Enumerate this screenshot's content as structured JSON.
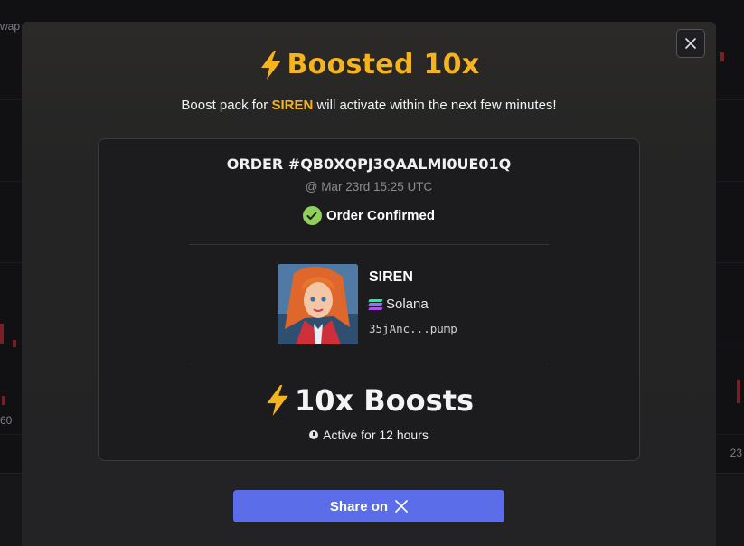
{
  "background": {
    "left_label": "wap",
    "price_label": "60",
    "right_label": "23"
  },
  "modal": {
    "title": "Boosted 10x",
    "subtitle_prefix": "Boost pack for",
    "subtitle_token": "SIREN",
    "subtitle_suffix": "will activate within the next few minutes!",
    "order": {
      "id_text": "ORDER #QB0XQPJ3QAALMI0UE01Q",
      "timestamp": "@ Mar 23rd 15:25 UTC",
      "status": "Order Confirmed"
    },
    "token": {
      "name": "SIREN",
      "chain": "Solana",
      "address": "35jAnc...pump"
    },
    "boosts_text": "10x Boosts",
    "active_text": "Active for 12 hours",
    "share_label": "Share on",
    "share_icon": "x-logo-icon",
    "colors": {
      "accent": "#f5b41d",
      "confirm": "#8fcf5a",
      "share_button": "#5b6de8"
    }
  }
}
